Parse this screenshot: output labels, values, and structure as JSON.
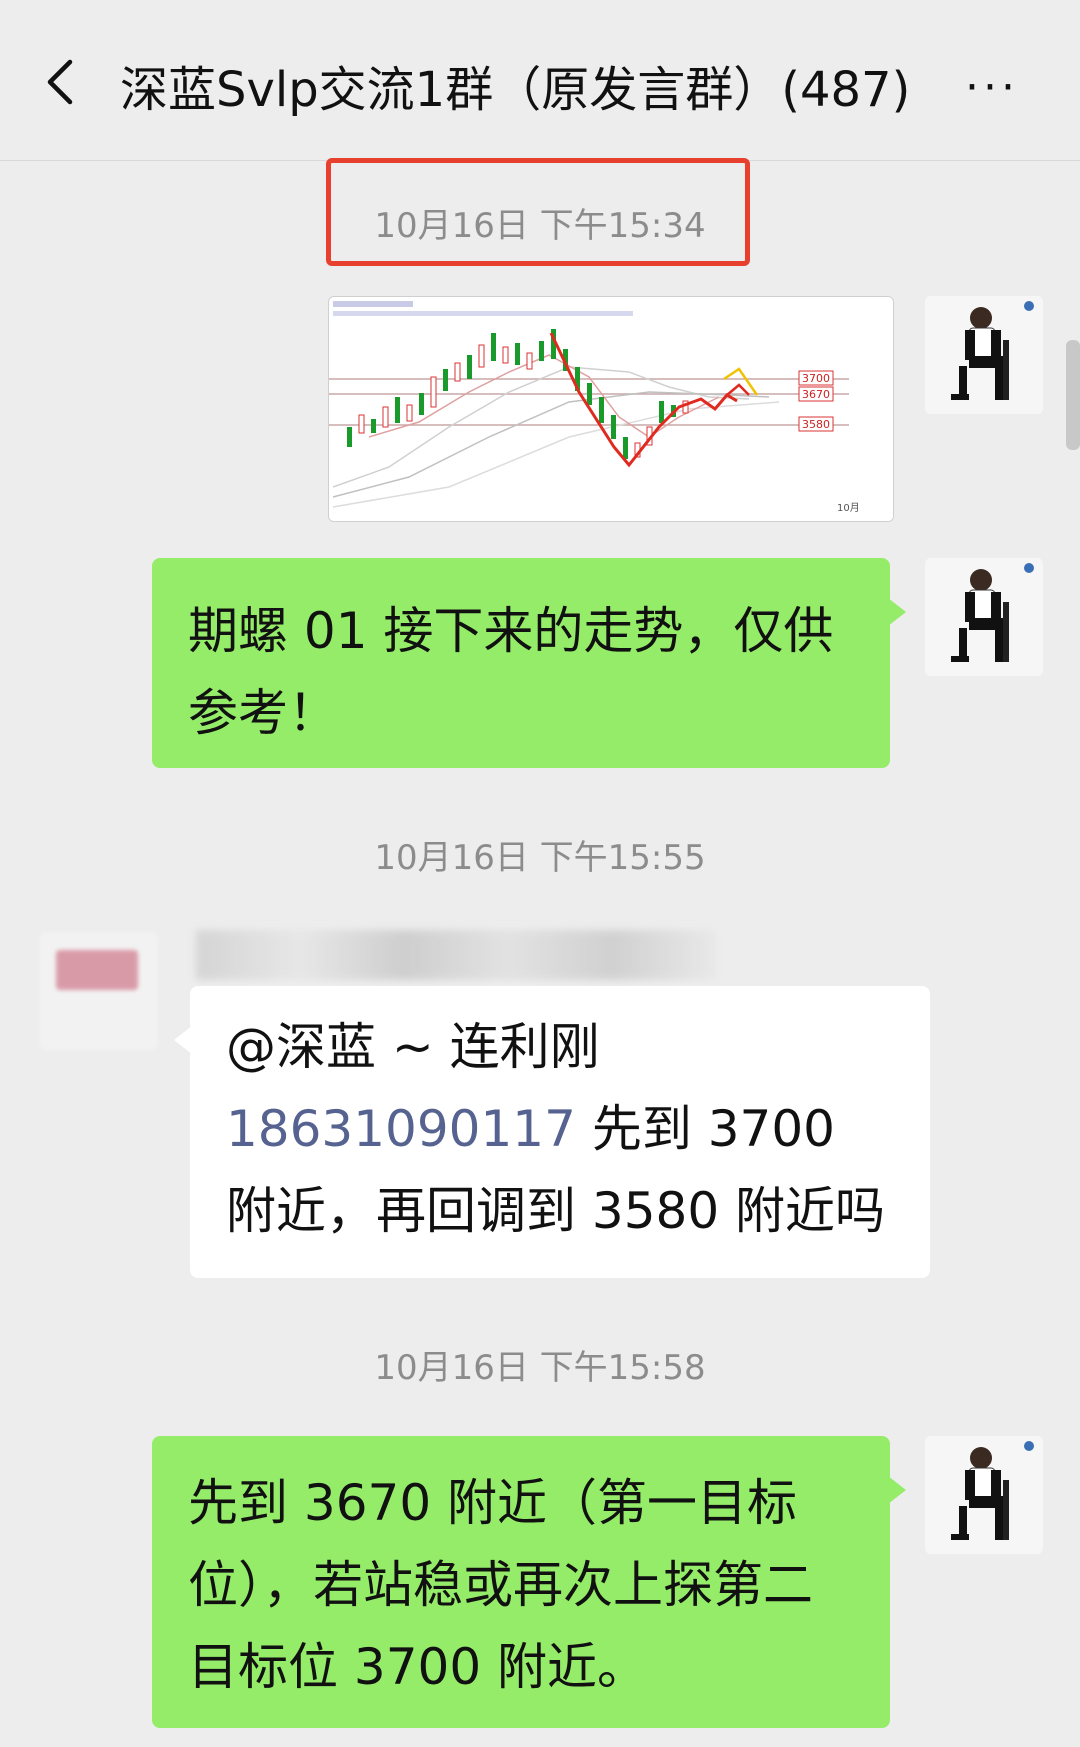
{
  "header": {
    "title": "深蓝Svlp交流1群（原发言群）(487)",
    "more_label": "···"
  },
  "messages": [
    {
      "type": "timestamp",
      "text": "10月16日 下午15:34",
      "highlighted": true
    },
    {
      "type": "image",
      "sender": "self",
      "chart_labels": [
        "3700",
        "3670",
        "3580",
        "10月"
      ]
    },
    {
      "type": "text",
      "sender": "self",
      "text": "期螺 01 接下来的走势，仅供参考！"
    },
    {
      "type": "timestamp",
      "text": "10月16日 下午15:55"
    },
    {
      "type": "text",
      "sender": "other",
      "mention": "@深蓝 ~ 连利刚",
      "phone": "18631090117",
      "text_after_phone": " 先到 3700 附近，再回调到 3580 附近吗"
    },
    {
      "type": "timestamp",
      "text": "10月16日 下午15:58"
    },
    {
      "type": "text",
      "sender": "self",
      "text": "先到 3670 附近（第一目标位），若站稳或再次上探第二目标位 3700 附近。"
    }
  ],
  "colors": {
    "background": "#ededed",
    "self_bubble": "#95ec69",
    "other_bubble": "#ffffff",
    "highlight_box": "#e8402e",
    "phone_link": "#56628f"
  },
  "icons": [
    "back-arrow-icon",
    "more-icon"
  ]
}
